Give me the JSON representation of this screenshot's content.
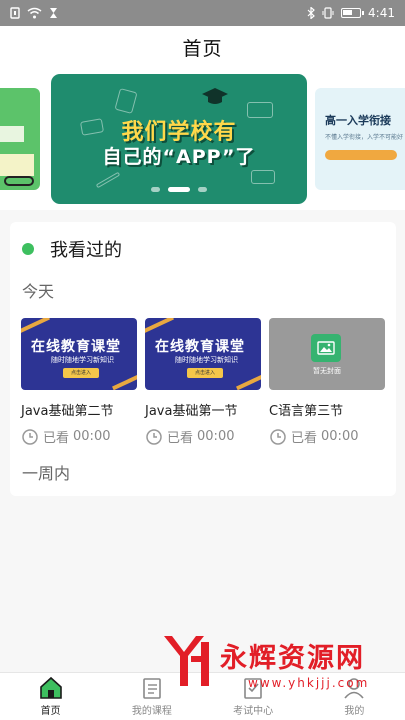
{
  "status_bar": {
    "time": "4:41",
    "icons": [
      "notification-icon",
      "wifi-icon",
      "hourglass-icon",
      "bluetooth-icon",
      "vibrate-icon",
      "battery-icon"
    ]
  },
  "header": {
    "title": "首页"
  },
  "banner": {
    "main": {
      "line1": "我们学校有",
      "line2": "自己的“APP”了"
    },
    "right": {
      "title": "高一入学衔接",
      "subtitle": "不懂入学衔接，入学不可能好"
    },
    "active_index": 1,
    "dot_count": 3
  },
  "history": {
    "title": "我看过的",
    "today_label": "今天",
    "week_label": "一周内",
    "courses": [
      {
        "name": "Java基础第二节",
        "watched": "已看",
        "time": "00:00",
        "cover_title": "在线教育课堂",
        "cover_sub": "随时随地学习新知识",
        "cover_btn": "点击进入"
      },
      {
        "name": "Java基础第一节",
        "watched": "已看",
        "time": "00:00",
        "cover_title": "在线教育课堂",
        "cover_sub": "随时随地学习新知识",
        "cover_btn": "点击进入"
      },
      {
        "name": "C语言第三节",
        "watched": "已看",
        "time": "00:00",
        "cover_placeholder": "暂无封面"
      }
    ]
  },
  "bottom_nav": {
    "items": [
      {
        "label": "首页",
        "icon": "home-icon",
        "active": true
      },
      {
        "label": "我的课程",
        "icon": "course-list-icon",
        "active": false
      },
      {
        "label": "考试中心",
        "icon": "exam-icon",
        "active": false
      },
      {
        "label": "我的",
        "icon": "profile-icon",
        "active": false
      }
    ]
  },
  "watermark": {
    "text": "永辉资源网",
    "url": "www.yhkjjj.com"
  },
  "colors": {
    "accent": "#3dbf5f",
    "banner_green": "#1f8c6e",
    "watermark_red": "#e21e27"
  }
}
